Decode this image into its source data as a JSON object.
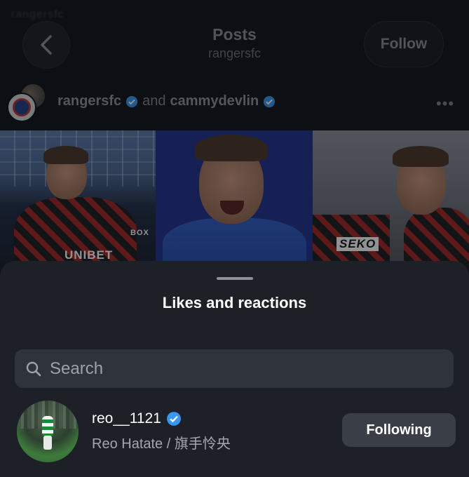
{
  "header": {
    "faint_top_text": "rangersfc",
    "title": "Posts",
    "subtitle": "rangersfc",
    "follow_label": "Follow"
  },
  "post": {
    "author_primary": "rangersfc",
    "conjunction": "and",
    "author_secondary": "cammydevlin",
    "more_icon": "more-horizontal-icon",
    "photos": [
      {
        "shirt_text": "UNIBET",
        "sleeve_text": "BOX"
      },
      {
        "shirt_text": ""
      },
      {
        "shirt_text": "SEKO"
      }
    ]
  },
  "sheet": {
    "title": "Likes and reactions",
    "search": {
      "placeholder": "Search"
    },
    "users": [
      {
        "username": "reo__1121",
        "full_name": "Reo Hatate / 旗手怜央",
        "verified": true,
        "action_label": "Following"
      }
    ]
  },
  "colors": {
    "background": "#0c0f13",
    "sheet": "#1d2127",
    "verified_badge": "#3897f0",
    "button": "#3a3f47"
  }
}
